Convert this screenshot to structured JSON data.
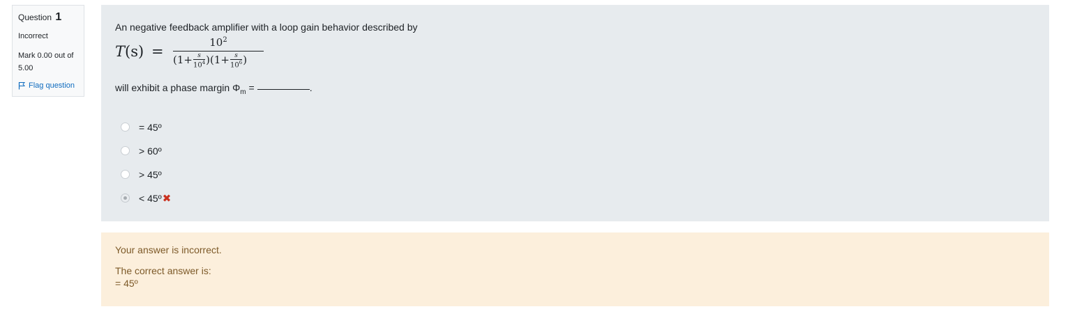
{
  "info": {
    "question_label": "Question",
    "question_number": "1",
    "state": "Incorrect",
    "grade_line1": "Mark 0.00 out of",
    "grade_line2": "5.00",
    "flag_label": "Flag question"
  },
  "question": {
    "text": "An negative feedback amplifier with a loop gain behavior described by",
    "formula": {
      "lhs_symbol": "T",
      "lhs_arg": "(s)",
      "equals": "=",
      "numerator_base": "10",
      "numerator_exp": "2",
      "d1_open": "(1+",
      "d1_top": "s",
      "d1_bot_base": "10",
      "d1_bot_exp": "4",
      "d2_open": ")(1+",
      "d2_top": "s",
      "d2_bot_base": "10",
      "d2_bot_exp": "6",
      "close": ")"
    },
    "phase_prefix": "will exhibit a phase margin Φ",
    "phase_sub": "m",
    "phase_equals": "=",
    "phase_suffix": "."
  },
  "answers": [
    {
      "label": "= 45º",
      "checked": false,
      "marked_wrong": false
    },
    {
      "label": "> 60º",
      "checked": false,
      "marked_wrong": false
    },
    {
      "label": "> 45º",
      "checked": false,
      "marked_wrong": false
    },
    {
      "label": "< 45º",
      "checked": true,
      "marked_wrong": true
    }
  ],
  "feedback": {
    "status": "Your answer is incorrect.",
    "correct_prefix": "The correct answer is:",
    "correct_value": "= 45º"
  },
  "colors": {
    "formulation_bg": "#e7ebee",
    "feedback_bg": "#fcefdc",
    "feedback_text": "#7d5a29",
    "link": "#0f6cbf",
    "incorrect_mark": "#ca3120"
  },
  "icons": {
    "flag": "flag-icon",
    "incorrect": "cross-icon"
  }
}
